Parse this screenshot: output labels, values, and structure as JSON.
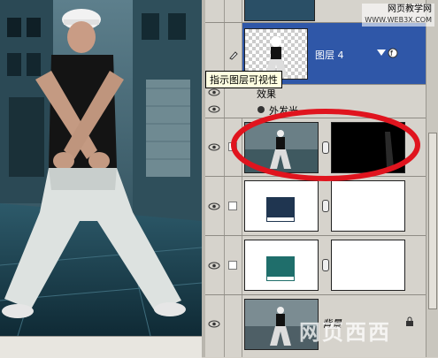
{
  "layers_panel": {
    "tooltip": "指示图层可视性",
    "layer4_name": "图层 4",
    "effects_label": "效果",
    "outer_glow_label": "外发光",
    "background_name": "背景",
    "ellipsis": "..."
  },
  "watermark": {
    "line1": "网页教学网",
    "line2": "WWW.WEB3X.COM"
  },
  "corner_watermark": "网页西西",
  "colors": {
    "fill_navy": "#1f3550",
    "fill_teal": "#1f6e6b",
    "highlight_blue": "#2f57a8",
    "annotation_red": "#e0141e"
  },
  "icons": [
    "eye-icon",
    "brush-icon",
    "chain-link-icon",
    "lock-icon",
    "fx-icon",
    "glow-icon"
  ]
}
